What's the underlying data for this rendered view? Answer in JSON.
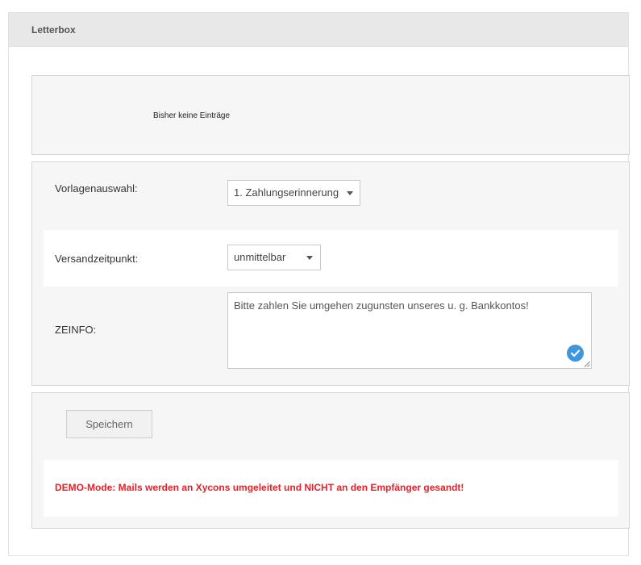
{
  "panel": {
    "title": "Letterbox"
  },
  "entries": {
    "empty_text": "Bisher keine Einträge"
  },
  "form": {
    "template": {
      "label": "Vorlagenauswahl:",
      "selected": "1. Zahlungserinnerung"
    },
    "send_time": {
      "label": "Versandzeitpunkt:",
      "selected": "unmittelbar"
    },
    "zeinfo": {
      "label": "ZEINFO:",
      "value": "Bitte zahlen Sie umgehen zugunsten unseres u. g. Bankkontos!"
    }
  },
  "actions": {
    "save_label": "Speichern",
    "demo_notice": "DEMO-Mode: Mails werden an Xycons umgeleitet und NICHT an den Empfänger gesandt!"
  },
  "colors": {
    "header_bg": "#e8e8e8",
    "box_bg": "#f6f6f6",
    "demo_notice": "#e8202a",
    "check_icon": "#3d97dd"
  },
  "icons": {
    "select_caret": "chevron-down-icon",
    "textarea_check": "check-circle-icon",
    "textarea_resize": "resize-handle-icon"
  }
}
